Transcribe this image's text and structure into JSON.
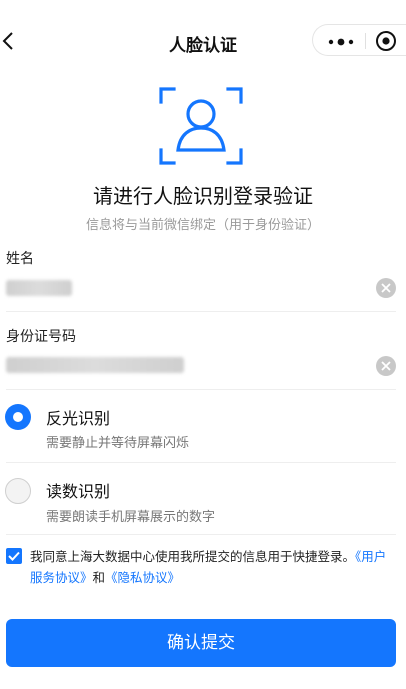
{
  "header": {
    "title": "人脸认证",
    "back_icon": "chevron-left-icon",
    "more_icon": "more-dots-icon",
    "close_icon": "circle-target-icon"
  },
  "intro": {
    "icon": "face-scan-icon",
    "headline": "请进行人脸识别登录验证",
    "subline": "信息将与当前微信绑定（用于身份验证）"
  },
  "form": {
    "name_label": "姓名",
    "name_value_obscured": true,
    "id_label": "身份证号码",
    "id_value_obscured": true,
    "clear_icon": "clear-circle-icon"
  },
  "options": [
    {
      "title": "反光识别",
      "desc": "需要静止并等待屏幕闪烁",
      "selected": true
    },
    {
      "title": "读数识别",
      "desc": "需要朗读手机屏幕展示的数字",
      "selected": false
    }
  ],
  "agreement": {
    "checked": true,
    "text_before": "我同意上海大数据中心使用我所提交的信息用于快捷登录。",
    "link_user": "《用户服务协议》",
    "conjunction": "和",
    "link_privacy": "《隐私协议》"
  },
  "submit_label": "确认提交",
  "colors": {
    "accent": "#1476fe",
    "muted_text": "#9a9a9a"
  }
}
